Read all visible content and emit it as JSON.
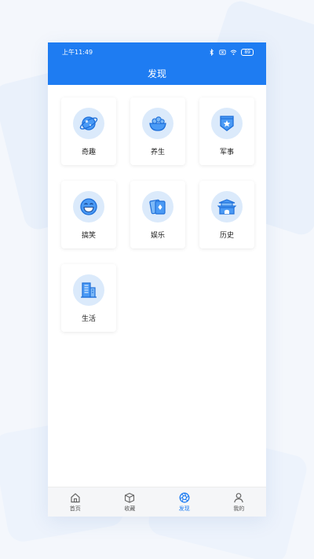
{
  "status_bar": {
    "time": "上午11:49",
    "battery": "89"
  },
  "header": {
    "title": "发现"
  },
  "categories": [
    {
      "label": "奇趣",
      "icon": "planet-icon"
    },
    {
      "label": "养生",
      "icon": "salad-bowl-icon"
    },
    {
      "label": "军事",
      "icon": "military-badge-icon"
    },
    {
      "label": "搞笑",
      "icon": "laughing-face-icon"
    },
    {
      "label": "娱乐",
      "icon": "playing-cards-icon"
    },
    {
      "label": "历史",
      "icon": "gate-tower-icon"
    },
    {
      "label": "生活",
      "icon": "buildings-icon"
    }
  ],
  "tabbar": {
    "items": [
      {
        "label": "首页",
        "icon": "home-icon",
        "active": false
      },
      {
        "label": "收藏",
        "icon": "box-icon",
        "active": false
      },
      {
        "label": "发现",
        "icon": "aperture-icon",
        "active": true
      },
      {
        "label": "我的",
        "icon": "person-icon",
        "active": false
      }
    ]
  },
  "colors": {
    "accent": "#1e7cf2",
    "icon_bg": "#dbeafb"
  }
}
